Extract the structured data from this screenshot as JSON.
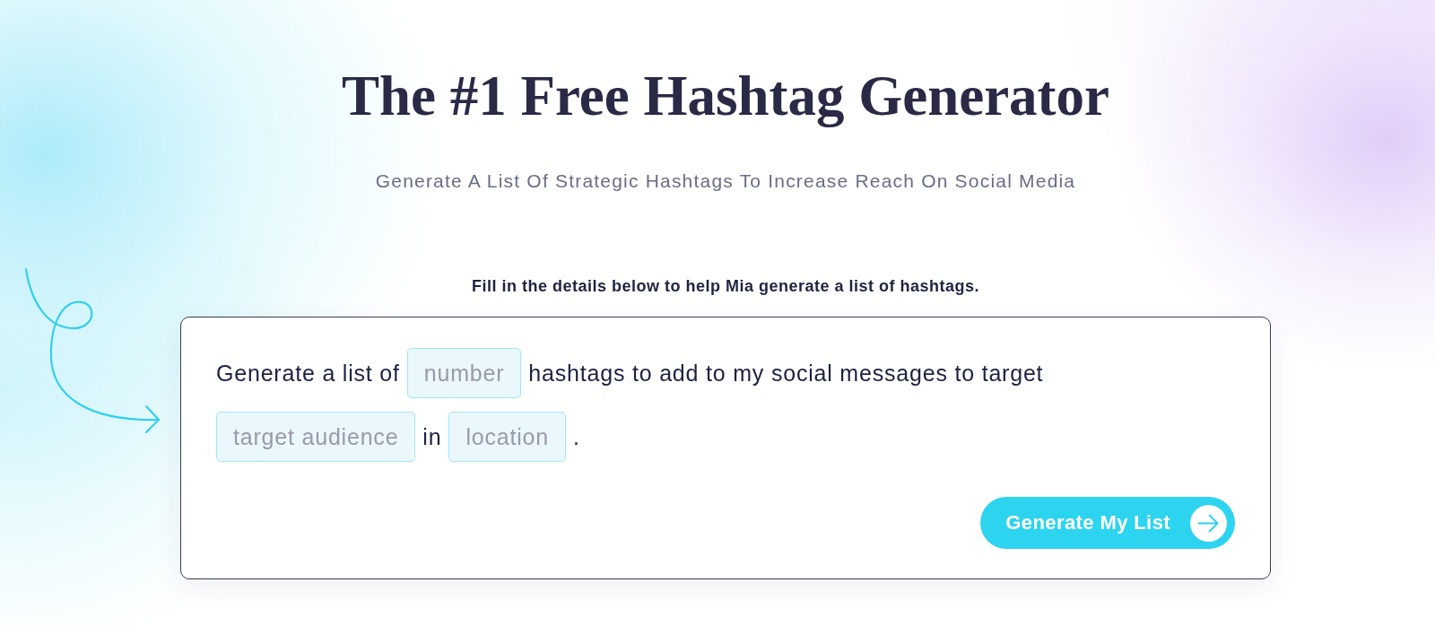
{
  "title": "The #1 Free Hashtag Generator",
  "subtitle": "Generate A List Of Strategic Hashtags To Increase Reach On Social Media",
  "instruction": "Fill in the details below to help Mia generate a list of hashtags.",
  "form": {
    "lines": [
      [
        {
          "kind": "text",
          "text": "Generate a list of"
        },
        {
          "kind": "field",
          "placeholder": "number"
        },
        {
          "kind": "text",
          "text": "hashtags to add to my social messages to target"
        }
      ],
      [
        {
          "kind": "field",
          "placeholder": "target audience"
        },
        {
          "kind": "text",
          "text": "in"
        },
        {
          "kind": "field",
          "placeholder": "location"
        },
        {
          "kind": "text",
          "text": "."
        }
      ]
    ],
    "submit_button": {
      "label": "Generate My List"
    }
  }
}
